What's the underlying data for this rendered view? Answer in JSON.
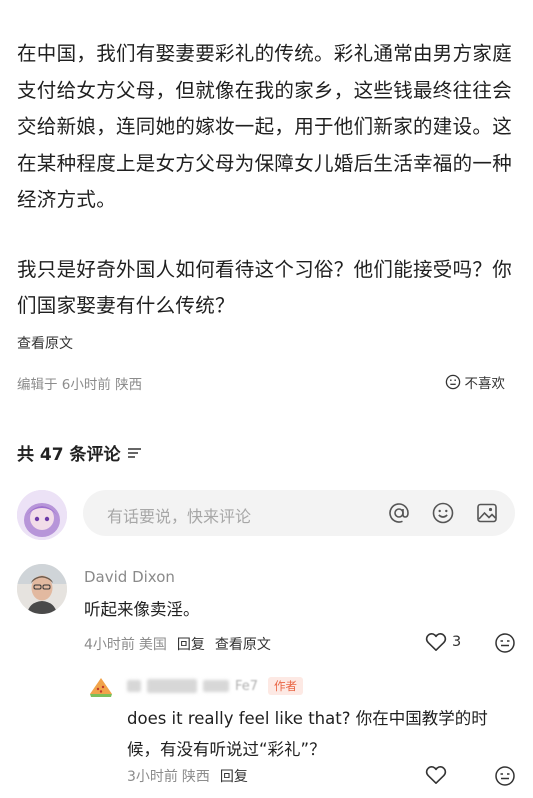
{
  "post": {
    "paragraph1": "在中国，我们有娶妻要彩礼的传统。彩礼通常由男方家庭支付给女方父母，但就像在我的家乡，这些钱最终往往会交给新娘，连同她的嫁妆一起，用于他们新家的建设。这在某种程度上是女方父母为保障女儿婚后生活幸福的一种经济方式。",
    "paragraph2": "我只是好奇外国人如何看待这个习俗？他们能接受吗？你们国家娶妻有什么传统？",
    "view_original": "查看原文",
    "edited_meta": "编辑于 6小时前 陕西",
    "dislike_label": "不喜欢"
  },
  "comments_header": {
    "label": "共 47 条评论"
  },
  "compose": {
    "placeholder": "有话要说，快来评论",
    "icons": [
      "at-icon",
      "emoji-icon",
      "image-icon"
    ]
  },
  "comments": [
    {
      "author": "David Dixon",
      "text": "听起来像卖淫。",
      "time": "4小时前",
      "location": "美国",
      "reply_label": "回复",
      "view_original_label": "查看原文",
      "likes": "3"
    }
  ],
  "reply": {
    "author_partial": "Fe7",
    "badge": "作者",
    "text": "does it really feel like that? 你在中国教学的时候，有没有听说过“彩礼”？",
    "time": "3小时前",
    "location": "陕西",
    "reply_label": "回复"
  },
  "colors": {
    "accent_badge_text": "#e96645",
    "accent_badge_bg": "#fde9e4",
    "meta_gray": "#8c8c8c"
  }
}
